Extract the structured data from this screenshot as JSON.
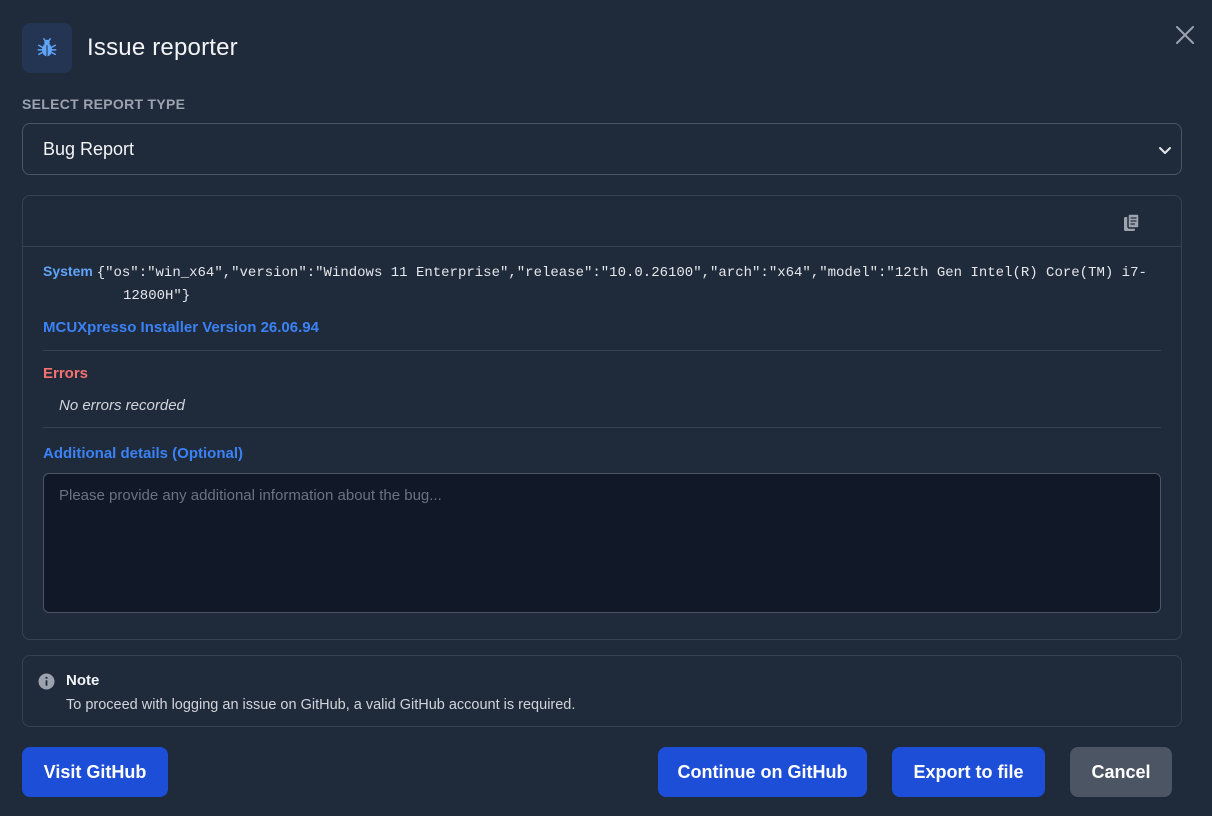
{
  "dialog": {
    "title": "Issue reporter",
    "icon": "bug-icon",
    "close_icon": "close-icon"
  },
  "report_type": {
    "label": "SELECT REPORT TYPE",
    "selected": "Bug Report"
  },
  "system_info": {
    "label": "System",
    "json_line1": "{\"os\":\"win_x64\",\"version\":\"Windows 11 Enterprise\",\"release\":\"10.0.26100\",\"arch\":\"x64\",\"model\":\"12th Gen Intel(R) Core(TM) i7-",
    "json_line2": "12800H\"}",
    "version_text": "MCUXpresso Installer Version 26.06.94"
  },
  "errors": {
    "label": "Errors",
    "empty_text": "No errors recorded"
  },
  "details": {
    "label": "Additional details (Optional)",
    "placeholder": "Please provide any additional information about the bug...",
    "value": ""
  },
  "note": {
    "title": "Note",
    "text": "To proceed with logging an issue on GitHub, a valid GitHub account is required."
  },
  "actions": {
    "visit_github": "Visit GitHub",
    "continue_github": "Continue on GitHub",
    "export": "Export to file",
    "cancel": "Cancel"
  },
  "colors": {
    "background": "#1f2a3a",
    "primary_button": "#1d4ed8",
    "secondary_button": "#4b5563",
    "link_blue": "#3b82f6",
    "error_red": "#f87171"
  }
}
